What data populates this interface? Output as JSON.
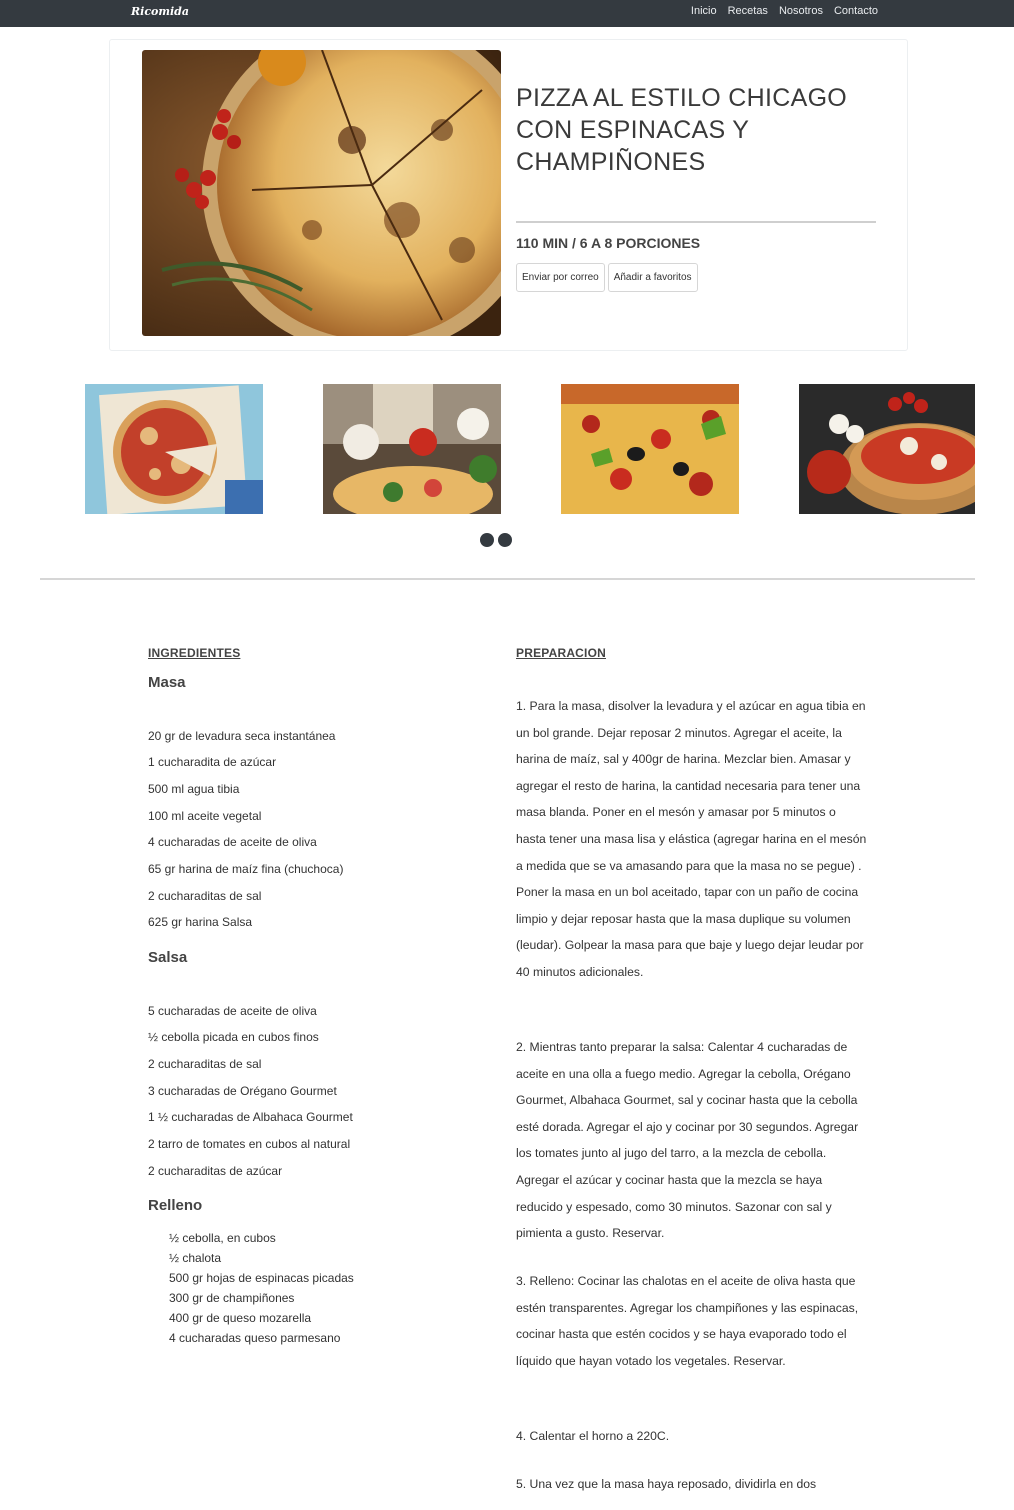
{
  "nav": {
    "brand": "Ricomida",
    "links": [
      "Inicio",
      "Recetas",
      "Nosotros",
      "Contacto"
    ]
  },
  "recipe": {
    "title": "PIZZA AL ESTILO CHICAGO CON ESPINACAS Y CHAMPIÑONES",
    "meta": "110 MIN / 6 A 8 PORCIONES",
    "buttons": [
      "Enviar por correo",
      "Añadir a favoritos"
    ]
  },
  "carousel": {
    "dots_count": 2
  },
  "ingredients": {
    "heading": "INGREDIENTES",
    "masa_title": "Masa",
    "masa": [
      "20 gr de levadura seca instantánea",
      "1 cucharadita de azúcar",
      "500 ml agua tibia",
      "100 ml aceite vegetal",
      "4 cucharadas de aceite de oliva",
      "65 gr harina de maíz fina (chuchoca)",
      "2 cucharaditas de sal",
      "625 gr harina Salsa"
    ],
    "salsa_title": "Salsa",
    "salsa": [
      "5 cucharadas de aceite de oliva",
      "½ cebolla picada en cubos finos",
      "2 cucharaditas de sal",
      "3 cucharadas de Orégano Gourmet",
      "1 ½ cucharadas de Albahaca Gourmet",
      "2 tarro de tomates en cubos al natural",
      "2 cucharaditas de azúcar"
    ],
    "relleno_title": "Relleno",
    "relleno": [
      "½ cebolla, en cubos",
      "½ chalota",
      "500 gr hojas de espinacas picadas",
      "300 gr de champiñones",
      "400 gr de queso mozarella",
      "4 cucharadas queso parmesano"
    ]
  },
  "preparation": {
    "heading": "PREPARACION",
    "steps": [
      "1. Para la masa, disolver la levadura y el azúcar en agua tibia en un bol grande. Dejar reposar 2 minutos. Agregar el aceite, la harina de maíz, sal y 400gr de harina. Mezclar bien. Amasar y agregar el resto de harina, la cantidad necesaria para tener una masa blanda. Poner en el mesón y amasar por 5 minutos o hasta tener una masa lisa y elástica (agregar harina en el mesón a medida que se va amasando para que la masa no se pegue) . Poner la masa en un bol aceitado, tapar con un paño de cocina limpio y dejar reposar hasta que la masa duplique su volumen (leudar). Golpear la masa para que baje y luego dejar leudar por 40 minutos adicionales.",
      "2. Mientras tanto preparar la salsa: Calentar 4 cucharadas de aceite en una olla a fuego medio. Agregar la cebolla, Orégano Gourmet, Albahaca Gourmet, sal y cocinar hasta que la cebolla esté dorada. Agregar el ajo y cocinar por 30 segundos. Agregar los tomates junto al jugo del tarro, a la mezcla de cebolla. Agregar el azúcar y cocinar hasta que la mezcla se haya reducido y espesado, como 30 minutos. Sazonar con sal y pimienta a gusto. Reservar.",
      "3. Relleno: Cocinar las chalotas en el aceite de oliva hasta que estén transparentes. Agregar los champiñones y las espinacas, cocinar hasta que estén cocidos y se haya evaporado todo el líquido que hayan votado los vegetales. Reservar.",
      "4. Calentar el horno a 220C.",
      "5. Una vez que la masa haya reposado, dividirla en dos"
    ]
  }
}
